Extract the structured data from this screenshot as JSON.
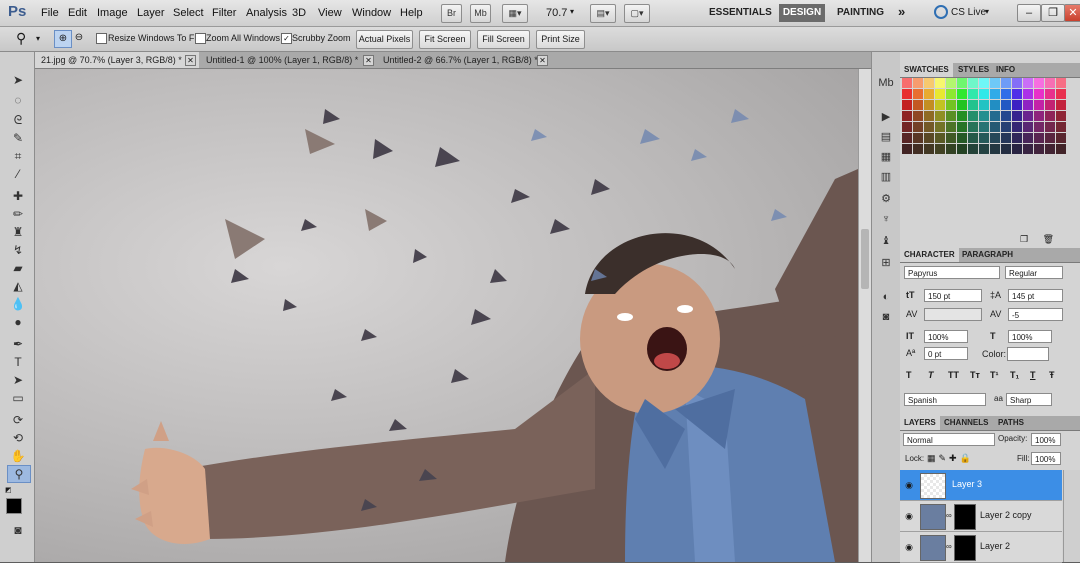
{
  "app": {
    "logo": "Ps"
  },
  "menu": [
    "File",
    "Edit",
    "Image",
    "Layer",
    "Select",
    "Filter",
    "Analysis",
    "3D",
    "View",
    "Window",
    "Help"
  ],
  "menubar": {
    "btn_br": "Br",
    "btn_mb": "Mb",
    "zoom": "70.7",
    "workspaces": {
      "essentials": "ESSENTIALS",
      "design": "DESIGN",
      "painting": "PAINTING",
      "more": "»"
    },
    "cslive": "CS Live"
  },
  "options": {
    "resize_windows": "Resize Windows To Fit",
    "zoom_all": "Zoom All Windows",
    "scrubby": "Scrubby Zoom",
    "scrubby_checked": "✓",
    "actual_pixels": "Actual Pixels",
    "fit_screen": "Fit Screen",
    "fill_screen": "Fill Screen",
    "print_size": "Print Size"
  },
  "tabs": [
    {
      "label": "21.jpg @ 70.7% (Layer 3, RGB/8) *"
    },
    {
      "label": "Untitled-1 @ 100% (Layer 1, RGB/8) *"
    },
    {
      "label": "Untitled-2 @ 66.7% (Layer 1, RGB/8) *"
    }
  ],
  "swatches": {
    "tabs": [
      "SWATCHES",
      "STYLES",
      "INFO"
    ]
  },
  "character": {
    "tabs": [
      "CHARACTER",
      "PARAGRAPH"
    ],
    "font": "Papyrus",
    "style": "Regular",
    "size": "150 pt",
    "leading": "145 pt",
    "tracking": "-5",
    "vscale": "100%",
    "hscale": "100%",
    "baseline": "0 pt",
    "color_label": "Color:",
    "glyphs": [
      "T",
      "T",
      "TT",
      "Tт",
      "T¹",
      "T₁",
      "T",
      "Ŧ"
    ],
    "language": "Spanish",
    "aa_prefix": "aa",
    "antialias": "Sharp"
  },
  "layers": {
    "tabs": [
      "LAYERS",
      "CHANNELS",
      "PATHS"
    ],
    "blend": "Normal",
    "opacity_label": "Opacity:",
    "opacity": "100%",
    "lock_label": "Lock:",
    "fill_label": "Fill:",
    "fill": "100%",
    "items": [
      {
        "name": "Layer 3"
      },
      {
        "name": "Layer 2 copy"
      },
      {
        "name": "Layer 2"
      }
    ]
  }
}
